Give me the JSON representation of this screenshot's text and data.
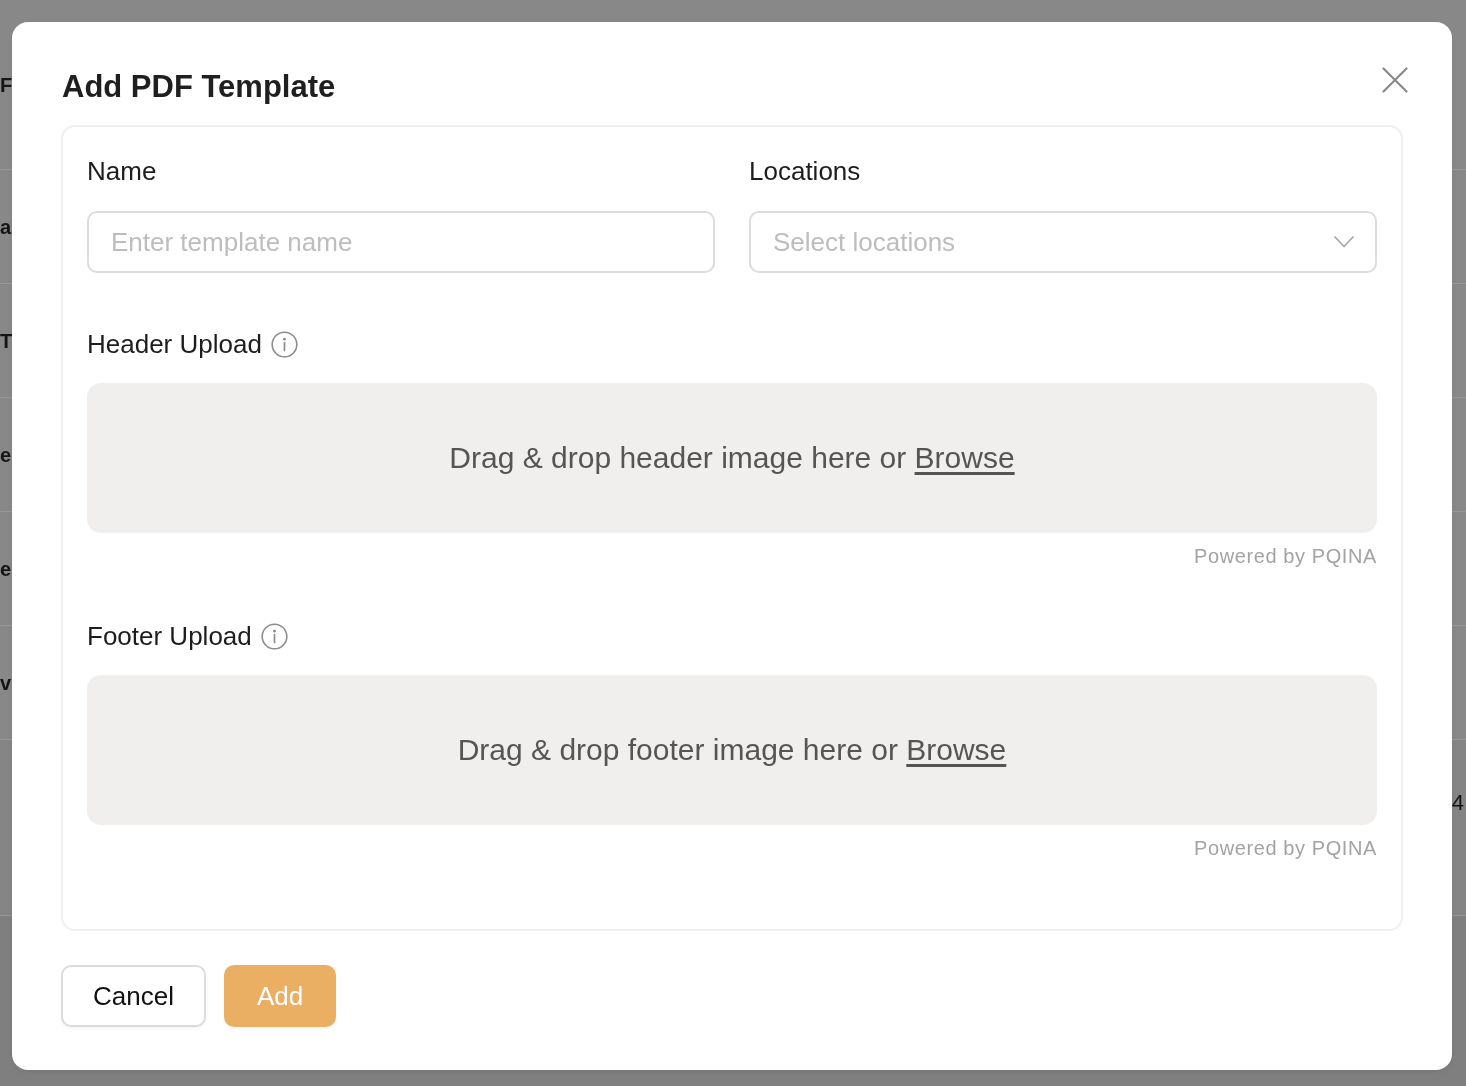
{
  "background": {
    "heading": "F",
    "rows": [
      {
        "start": "a"
      },
      {
        "start": "T"
      },
      {
        "start": "e"
      },
      {
        "start": "e"
      },
      {
        "start": "v"
      },
      {
        "end": "4"
      }
    ]
  },
  "dialog": {
    "title": "Add PDF Template",
    "fields": [
      {
        "kind": "text",
        "label": "Name",
        "placeholder": "Enter template name"
      },
      {
        "kind": "select",
        "label": "Locations",
        "placeholder": "Select locations"
      }
    ],
    "uploads": [
      {
        "label": "Header Upload",
        "prompt": "Drag & drop header image here or",
        "link": "Browse",
        "credit": "Powered by PQINA"
      },
      {
        "label": "Footer Upload",
        "prompt": "Drag & drop footer image here or",
        "link": "Browse",
        "credit": "Powered by PQINA"
      }
    ],
    "buttons": [
      {
        "kind": "secondary",
        "label": "Cancel"
      },
      {
        "kind": "primary",
        "label": "Add"
      }
    ]
  }
}
